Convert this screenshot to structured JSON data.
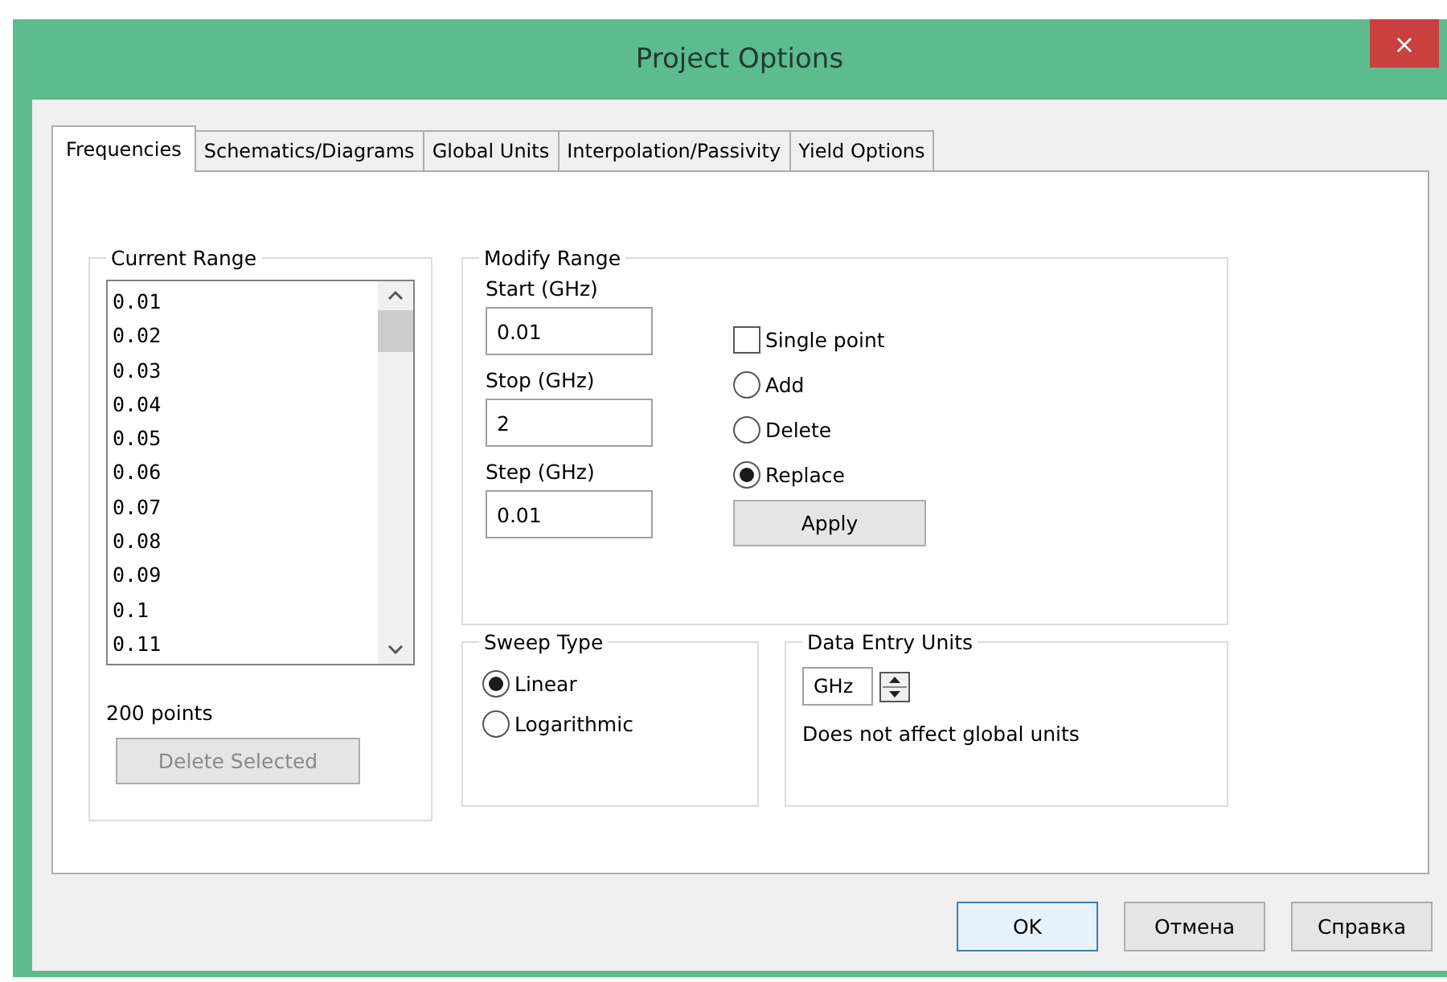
{
  "window": {
    "title": "Project Options",
    "close": "×"
  },
  "tabs": [
    {
      "label": "Frequencies",
      "selected": true
    },
    {
      "label": "Schematics/Diagrams",
      "selected": false
    },
    {
      "label": "Global Units",
      "selected": false
    },
    {
      "label": "Interpolation/Passivity",
      "selected": false
    },
    {
      "label": "Yield Options",
      "selected": false
    }
  ],
  "current_range": {
    "title": "Current Range",
    "items": [
      "0.01",
      "0.02",
      "0.03",
      "0.04",
      "0.05",
      "0.06",
      "0.07",
      "0.08",
      "0.09",
      "0.1",
      "0.11"
    ],
    "count": "200 points",
    "delete_button": {
      "label": "Delete Selected",
      "disabled": true
    }
  },
  "modify_range": {
    "title": "Modify Range",
    "fields": [
      {
        "label": "Start (GHz)",
        "value": "0.01"
      },
      {
        "label": "Stop (GHz)",
        "value": "2"
      },
      {
        "label": "Step (GHz)",
        "value": "0.01"
      }
    ],
    "single_point": {
      "label": "Single point",
      "checked": false
    },
    "modes": [
      {
        "label": "Add",
        "selected": false
      },
      {
        "label": "Delete",
        "selected": false
      },
      {
        "label": "Replace",
        "selected": true
      }
    ],
    "apply_button": "Apply"
  },
  "sweep_type": {
    "title": "Sweep Type",
    "options": [
      {
        "label": "Linear",
        "selected": true
      },
      {
        "label": "Logarithmic",
        "selected": false
      }
    ]
  },
  "data_entry_units": {
    "title": "Data Entry Units",
    "unit": "GHz",
    "note": "Does not affect global units"
  },
  "buttons": [
    {
      "label": "OK",
      "default": true
    },
    {
      "label": "Отмена",
      "default": false
    },
    {
      "label": "Справка",
      "default": false
    }
  ]
}
